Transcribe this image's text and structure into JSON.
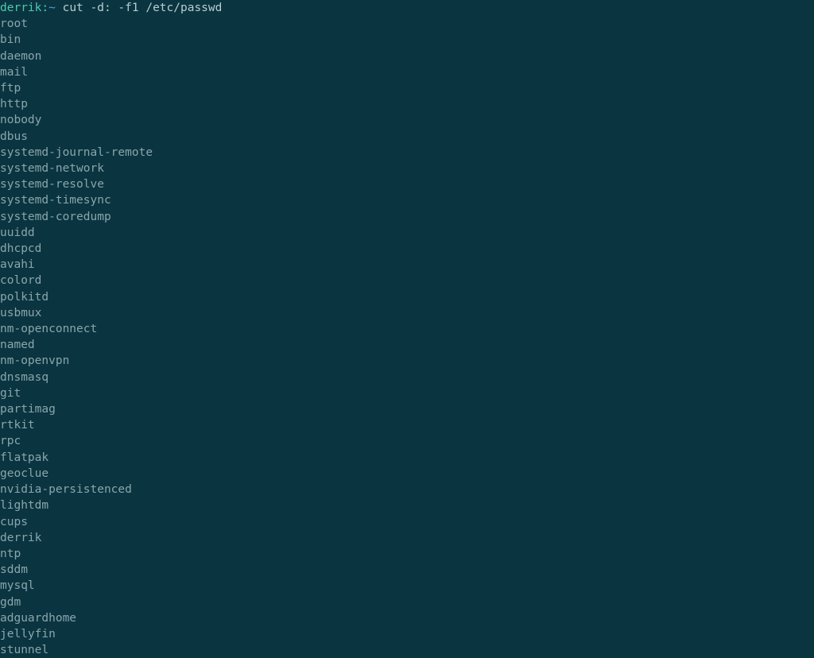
{
  "prompt": {
    "user": "derrik",
    "separator": ":",
    "path": "~",
    "command": " cut -d: -f1 /etc/passwd"
  },
  "output": [
    "root",
    "bin",
    "daemon",
    "mail",
    "ftp",
    "http",
    "nobody",
    "dbus",
    "systemd-journal-remote",
    "systemd-network",
    "systemd-resolve",
    "systemd-timesync",
    "systemd-coredump",
    "uuidd",
    "dhcpcd",
    "avahi",
    "colord",
    "polkitd",
    "usbmux",
    "nm-openconnect",
    "named",
    "nm-openvpn",
    "dnsmasq",
    "git",
    "partimag",
    "rtkit",
    "rpc",
    "flatpak",
    "geoclue",
    "nvidia-persistenced",
    "lightdm",
    "cups",
    "derrik",
    "ntp",
    "sddm",
    "mysql",
    "gdm",
    "adguardhome",
    "jellyfin",
    "stunnel"
  ]
}
